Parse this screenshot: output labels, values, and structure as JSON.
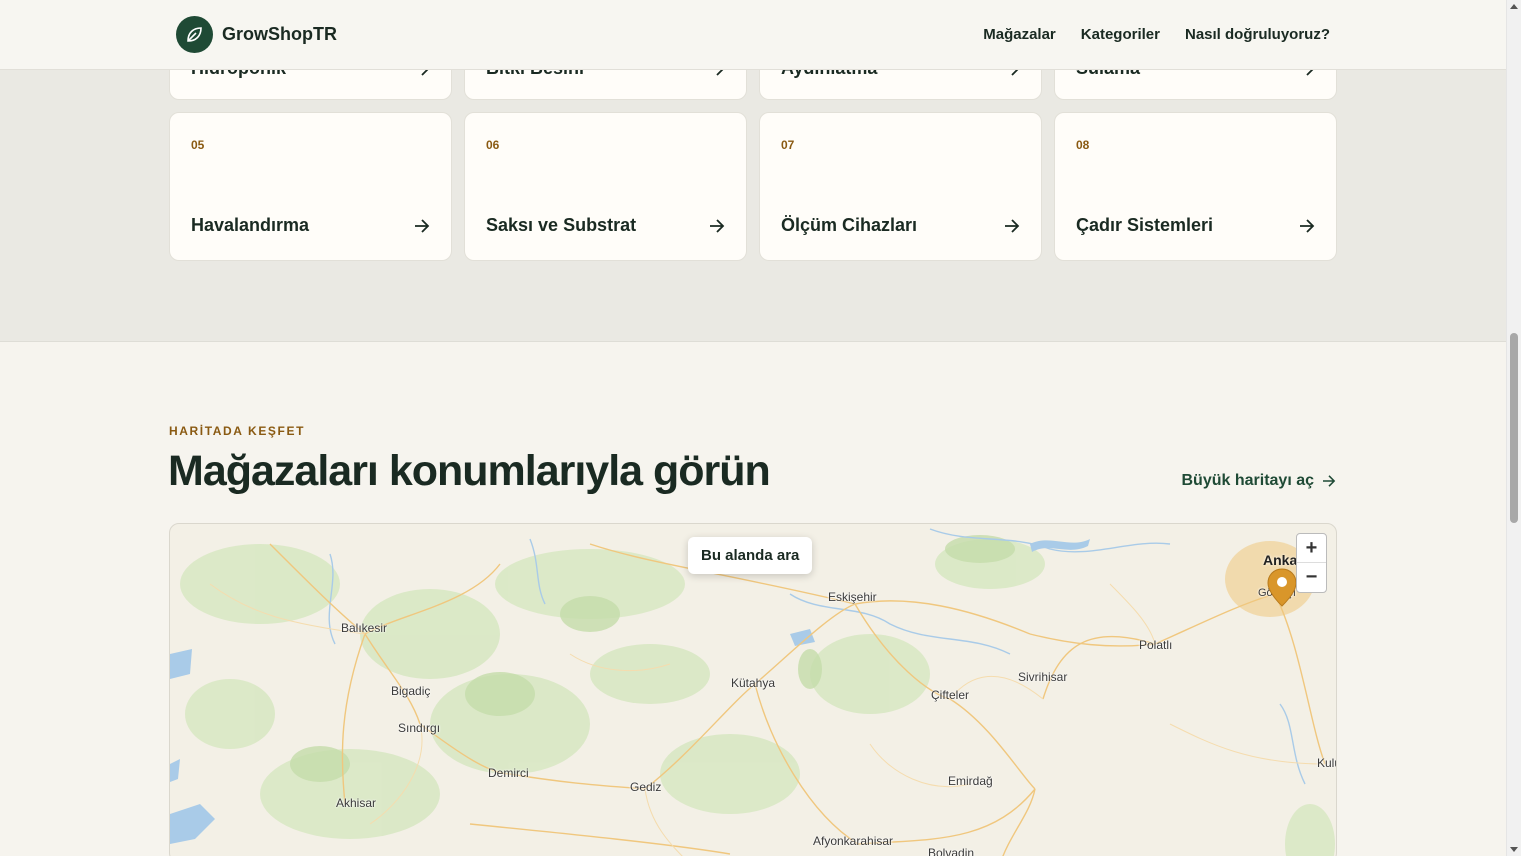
{
  "header": {
    "brand": "GrowShopTR",
    "nav": [
      "Mağazalar",
      "Kategoriler",
      "Nasıl doğruluyoruz?"
    ]
  },
  "categories": {
    "top_row": [
      {
        "title": "Hidroponik"
      },
      {
        "title": "Bitki Besini"
      },
      {
        "title": "Aydınlatma"
      },
      {
        "title": "Sulama"
      }
    ],
    "bottom_row": [
      {
        "num": "05",
        "title": "Havalandırma"
      },
      {
        "num": "06",
        "title": "Saksı ve Substrat"
      },
      {
        "num": "07",
        "title": "Ölçüm Cihazları"
      },
      {
        "num": "08",
        "title": "Çadır Sistemleri"
      }
    ]
  },
  "map_section": {
    "eyebrow": "HARİTADA KEŞFET",
    "title": "Mağazaları konumlarıyla görün",
    "big_map_link": "Büyük haritayı aç",
    "search_area_button": "Bu alanda ara",
    "zoom_in": "+",
    "zoom_out": "−",
    "cities": [
      "Eskişehir",
      "Balıkesir",
      "Polatlı",
      "Sivrihisar",
      "Kütahya",
      "Çifteler",
      "Bigadiç",
      "Sındırgı",
      "Demirci",
      "Emirdağ",
      "Gediz",
      "Akhisar",
      "Afyonkarahisar",
      "Bolvadin",
      "Kulu",
      "Gölbaşı"
    ],
    "ankara_label": "Anka",
    "marker_color": "#d9962a"
  },
  "colors": {
    "brand_green": "#1f4a35",
    "accent_amber": "#8a5a12"
  }
}
